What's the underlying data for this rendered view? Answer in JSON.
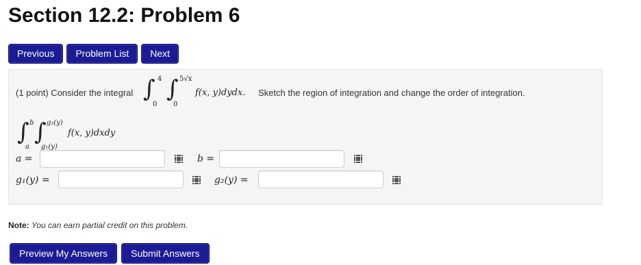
{
  "page": {
    "title": "Section 12.2: Problem 6"
  },
  "nav": {
    "previous": "Previous",
    "problem_list": "Problem List",
    "next": "Next"
  },
  "problem": {
    "points": "(1 point) Consider the integral",
    "given_integral": {
      "outer_lower": "0",
      "outer_upper": "4",
      "inner_lower": "0",
      "inner_upper": "5√x",
      "integrand": "f(x, y)dydx."
    },
    "instruction": "Sketch the region of integration and change the order of integration.",
    "target_integral": {
      "outer_lower": "a",
      "outer_upper": "b",
      "inner_lower": "g₁(y)",
      "inner_upper": "g₂(y)",
      "integrand": "f(x, y)dxdy"
    },
    "fields": {
      "a_label": "a =",
      "b_label": "b =",
      "g1_label": "g₁(y) =",
      "g2_label": "g₂(y) =",
      "a_value": "",
      "b_value": "",
      "g1_value": "",
      "g2_value": ""
    }
  },
  "note": {
    "label": "Note:",
    "text": "You can earn partial credit on this problem."
  },
  "actions": {
    "preview": "Preview My Answers",
    "submit": "Submit Answers"
  },
  "icons": {
    "math_keyboard": "equation-editor-grid-icon"
  },
  "colors": {
    "button": "#1b1b96",
    "box_bg": "#f5f5f5"
  }
}
